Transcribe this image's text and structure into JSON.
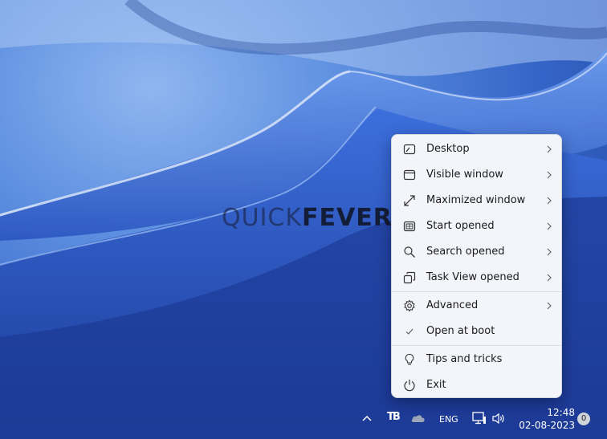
{
  "watermark": {
    "part1": "QUICK",
    "part2": "FEVER"
  },
  "menu": {
    "items": [
      {
        "label": "Desktop",
        "icon": "desktop-icon",
        "submenu": true
      },
      {
        "label": "Visible window",
        "icon": "window-icon",
        "submenu": true
      },
      {
        "label": "Maximized window",
        "icon": "maximize-icon",
        "submenu": true
      },
      {
        "label": "Start opened",
        "icon": "start-menu-icon",
        "submenu": true
      },
      {
        "label": "Search opened",
        "icon": "search-icon",
        "submenu": true
      },
      {
        "label": "Task View opened",
        "icon": "task-view-icon",
        "submenu": true
      },
      {
        "label": "Advanced",
        "icon": "gear-icon",
        "submenu": true
      },
      {
        "label": "Open at boot",
        "icon": "checkmark-icon",
        "submenu": false
      },
      {
        "label": "Tips and tricks",
        "icon": "lightbulb-icon",
        "submenu": false
      },
      {
        "label": "Exit",
        "icon": "power-icon",
        "submenu": false
      }
    ]
  },
  "taskbar": {
    "language": "ENG",
    "time": "12:48",
    "date": "02-08-2023",
    "notification_count": "0",
    "app_icon_text": "TB"
  },
  "colors": {
    "menu_bg": "#f3f5fa",
    "accent": "#3565c8"
  }
}
